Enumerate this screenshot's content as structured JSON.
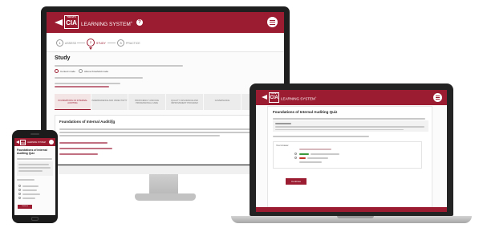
{
  "brand": {
    "logo_top": "THE IIA'S",
    "logo_main": "CIA",
    "product": "LEARNING SYSTEM",
    "mark": "®"
  },
  "steps": [
    {
      "num": "1",
      "label": "ASSESS"
    },
    {
      "num": "2",
      "label": "STUDY"
    },
    {
      "num": "3",
      "label": "PRACTICE"
    }
  ],
  "study": {
    "heading": "Study",
    "radio_1": "Content mode",
    "radio_2": "Above threshold mode"
  },
  "tabs": [
    "FOUNDATIONS OF INTERNAL AUDITING",
    "INDEPENDENCE AND OBJECTIVITY",
    "PROFICIENCY AND DUE PROFESSIONAL CARE",
    "QUALITY ASSURANCE AND IMPROVEMENT PROGRAM",
    "GOVERNANCE",
    "RISK MANAGEMENT"
  ],
  "section_title": "Foundations of Internal Auditing",
  "quiz_title": "Foundations of Internal Auditing Quiz",
  "quiz_label": "Your Answer",
  "continue_label": "Continue",
  "phone_title": "Foundations of Internal Auditing Quiz",
  "colors": {
    "accent": "#9b1b30",
    "correct": "#3b9a3b",
    "wrong": "#c0392b"
  }
}
